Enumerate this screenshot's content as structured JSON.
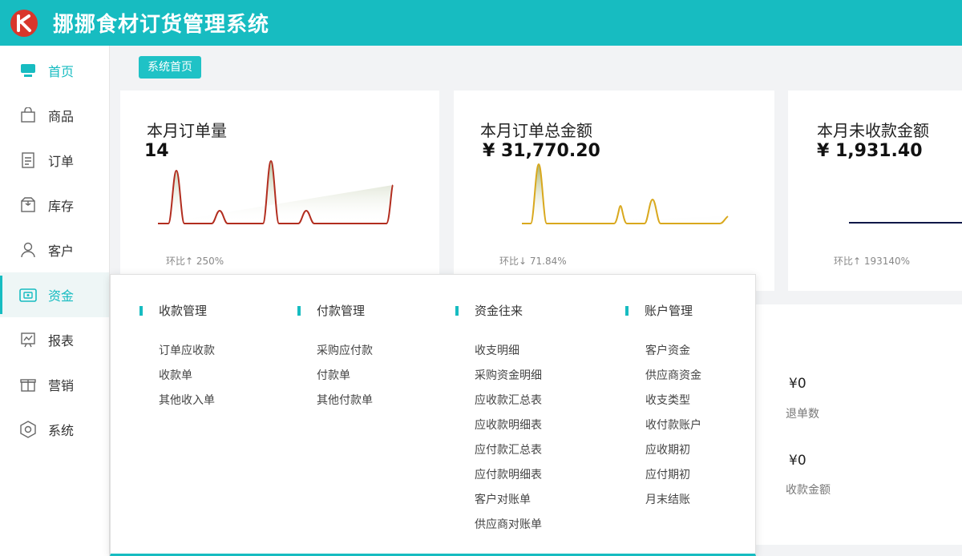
{
  "app": {
    "title": "挪挪食材订货管理系统"
  },
  "sidebar": {
    "items": [
      {
        "label": "首页",
        "icon": "monitor-icon"
      },
      {
        "label": "商品",
        "icon": "bag-icon"
      },
      {
        "label": "订单",
        "icon": "document-icon"
      },
      {
        "label": "库存",
        "icon": "box-icon"
      },
      {
        "label": "客户",
        "icon": "user-icon"
      },
      {
        "label": "资金",
        "icon": "wallet-icon"
      },
      {
        "label": "报表",
        "icon": "chart-icon"
      },
      {
        "label": "营销",
        "icon": "gift-icon"
      },
      {
        "label": "系统",
        "icon": "settings-hex-icon"
      }
    ]
  },
  "breadcrumb": "系统首页",
  "cards": [
    {
      "title": "本月订单量",
      "value": "14",
      "foot": "环比↑  250%"
    },
    {
      "title": "本月订单总金额",
      "value": "¥ 31,770.20",
      "foot": "环比↓  71.84%"
    },
    {
      "title": "本月未收款金额",
      "value": "¥ 1,931.40",
      "foot": "环比↑  193140%"
    }
  ],
  "stats": [
    {
      "value": "¥0",
      "label": "退单数"
    },
    {
      "value": "¥0",
      "label": "收款金额"
    }
  ],
  "finance_menu": {
    "columns": [
      {
        "heading": "收款管理",
        "items": [
          "订单应收款",
          "收款单",
          "其他收入单"
        ]
      },
      {
        "heading": "付款管理",
        "items": [
          "采购应付款",
          "付款单",
          "其他付款单"
        ]
      },
      {
        "heading": "资金往来",
        "items": [
          "收支明细",
          "采购资金明细",
          "应收款汇总表",
          "应收款明细表",
          "应付款汇总表",
          "应付款明细表",
          "客户对账单",
          "供应商对账单"
        ]
      },
      {
        "heading": "账户管理",
        "items": [
          "客户资金",
          "供应商资金",
          "收支类型",
          "收付款账户",
          "应收期初",
          "应付期初",
          "月末结账"
        ]
      }
    ]
  },
  "colors": {
    "accent": "#17bcc1",
    "line1": "#b22d1f",
    "line2": "#d9a81d",
    "line3": "#0f1848"
  }
}
